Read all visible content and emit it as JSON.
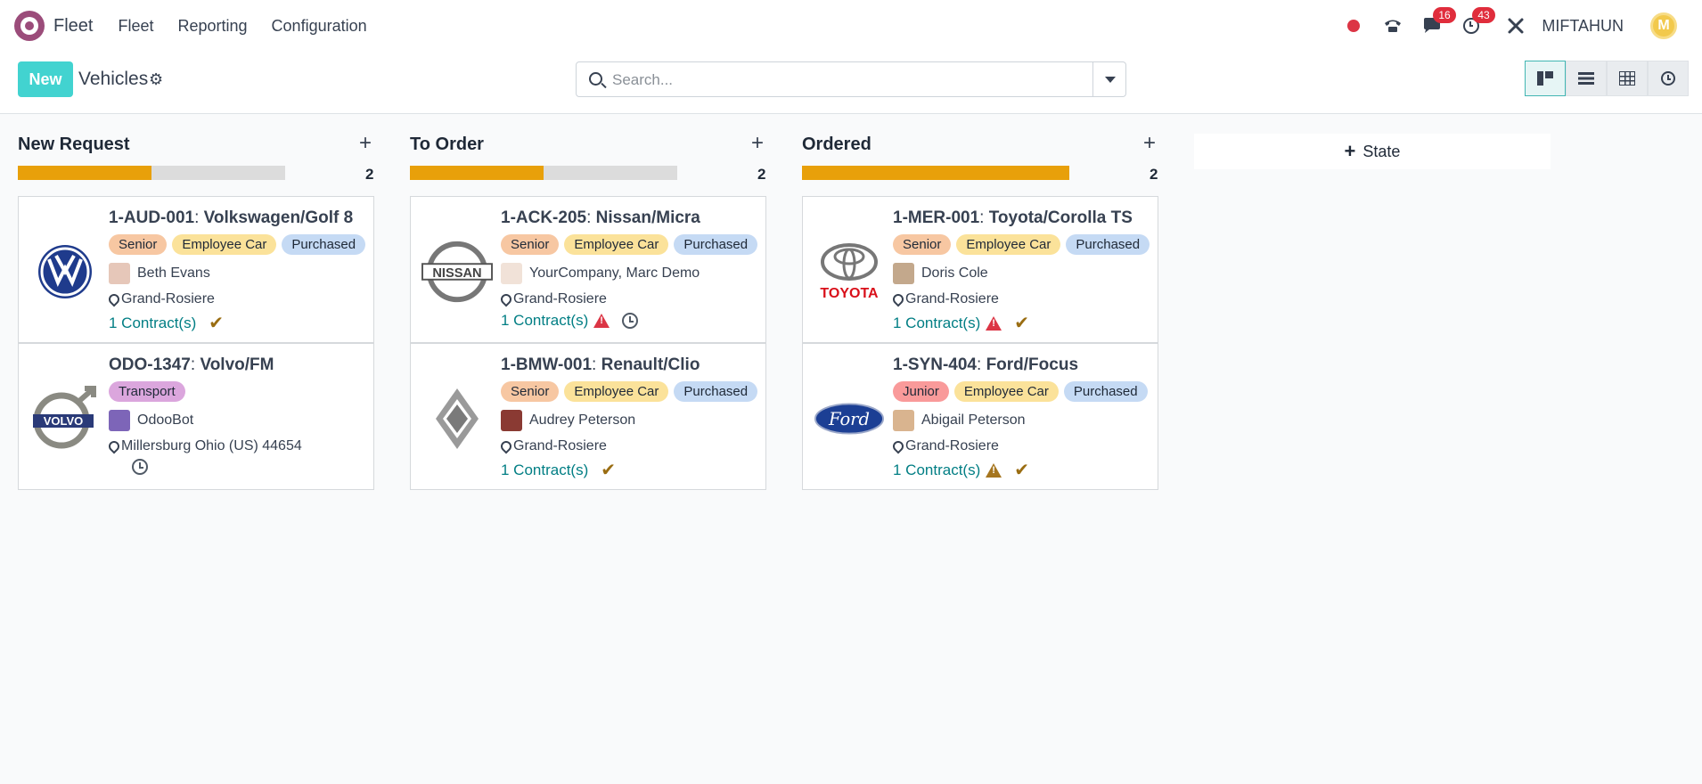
{
  "navbar": {
    "app_name": "Fleet",
    "menu": [
      "Fleet",
      "Reporting",
      "Configuration"
    ],
    "messages_count": "16",
    "activities_count": "43",
    "user_name": "MIFTAHUN",
    "user_initial": "M"
  },
  "control_panel": {
    "new_label": "New",
    "title": "Vehicles",
    "search_placeholder": "Search..."
  },
  "add_column_label": "State",
  "columns": [
    {
      "title": "New Request",
      "count": "2",
      "progress_fraction": 0.5,
      "cards": [
        {
          "plate": "1-AUD-001",
          "model": "Volkswagen/Golf 8",
          "logo": "volkswagen-logo",
          "tags": [
            "Senior",
            "Employee Car",
            "Purchased"
          ],
          "driver": "Beth Evans",
          "location": "Grand-Rosiere",
          "contracts": "1 Contract(s)",
          "status": "check"
        },
        {
          "plate": "ODO-1347",
          "model": "Volvo/FM",
          "logo": "volvo-logo",
          "tags": [
            "Transport"
          ],
          "driver": "OdooBot",
          "location": "Millersburg Ohio (US) 44654",
          "contracts": "",
          "status": "clock"
        }
      ]
    },
    {
      "title": "To Order",
      "count": "2",
      "progress_fraction": 0.5,
      "cards": [
        {
          "plate": "1-ACK-205",
          "model": "Nissan/Micra",
          "logo": "nissan-logo",
          "tags": [
            "Senior",
            "Employee Car",
            "Purchased"
          ],
          "driver": "YourCompany, Marc Demo",
          "location": "Grand-Rosiere",
          "contracts": "1 Contract(s)",
          "status": "warn-clock"
        },
        {
          "plate": "1-BMW-001",
          "model": "Renault/Clio",
          "logo": "renault-logo",
          "tags": [
            "Senior",
            "Employee Car",
            "Purchased"
          ],
          "driver": "Audrey Peterson",
          "location": "Grand-Rosiere",
          "contracts": "1 Contract(s)",
          "status": "check"
        }
      ]
    },
    {
      "title": "Ordered",
      "count": "2",
      "progress_fraction": 1.0,
      "cards": [
        {
          "plate": "1-MER-001",
          "model": "Toyota/Corolla TS",
          "logo": "toyota-logo",
          "tags": [
            "Senior",
            "Employee Car",
            "Purchased"
          ],
          "driver": "Doris Cole",
          "location": "Grand-Rosiere",
          "contracts": "1 Contract(s)",
          "status": "warn-check"
        },
        {
          "plate": "1-SYN-404",
          "model": "Ford/Focus",
          "logo": "ford-logo",
          "tags": [
            "Junior",
            "Employee Car",
            "Purchased"
          ],
          "driver": "Abigail Peterson",
          "location": "Grand-Rosiere",
          "contracts": "1 Contract(s)",
          "status": "warnorange-check"
        }
      ]
    }
  ],
  "colors": {
    "accent": "#42d3d0",
    "progress": "#e8a00a",
    "link": "#017e84",
    "badge": "#e02d3c"
  }
}
